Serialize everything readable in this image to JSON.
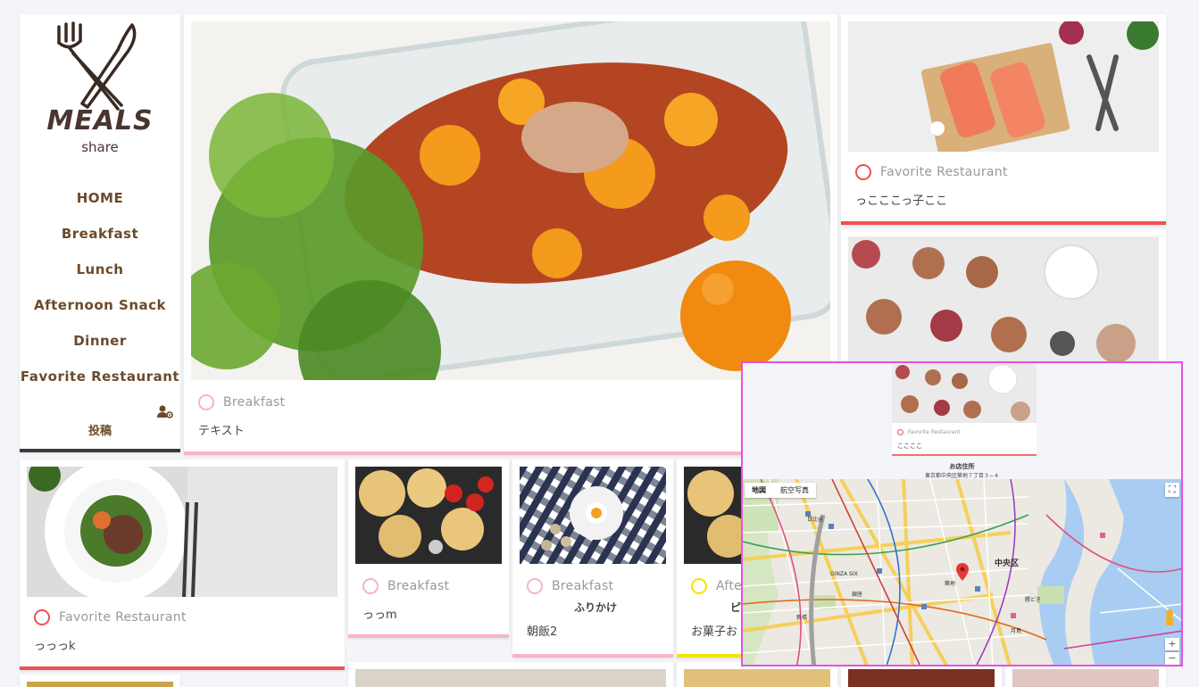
{
  "brand": {
    "name": "MEALS",
    "tagline": "share"
  },
  "nav": {
    "items": [
      {
        "label": "HOME"
      },
      {
        "label": "Breakfast"
      },
      {
        "label": "Lunch"
      },
      {
        "label": "Afternoon Snack"
      },
      {
        "label": "Dinner"
      },
      {
        "label": "Favorite Restaurant"
      }
    ],
    "post_label": "投稿"
  },
  "posts": [
    {
      "category": "Breakfast",
      "description": "テキスト",
      "accent": "#f7b4c4"
    },
    {
      "category": "Favorite Restaurant",
      "description": "っこここっ子ここ",
      "accent": "#f05050"
    },
    {
      "category": "Favorite Restaurant",
      "description": "っっっk",
      "accent": "#f05050"
    },
    {
      "category": "Breakfast",
      "description": "っっm",
      "accent": "#f7b4c4"
    },
    {
      "category": "Breakfast",
      "title": "ふりかけ",
      "description": "朝飯2",
      "accent": "#f7b4c4"
    },
    {
      "category": "Afte",
      "title": "ピ",
      "description": "お菓子お",
      "accent": "#f4e400"
    }
  ],
  "popup": {
    "card": {
      "category": "Favorite Restaurant",
      "description": "ここここ"
    },
    "store_label": "お店住所",
    "address": "東京都中央区築地７丁目３−４",
    "map_types": [
      "地図",
      "航空写真"
    ],
    "district": "中央区",
    "place_labels": [
      "GINZA SIX",
      "銀座",
      "築地",
      "勝どき",
      "月島",
      "新橋",
      "日比谷"
    ]
  },
  "colors": {
    "accent_pink": "#f7b4c4",
    "accent_red": "#f05050",
    "accent_yellow": "#f4e400",
    "brand_brown": "#6b4a2b",
    "popup_border": "#e94fe0"
  }
}
